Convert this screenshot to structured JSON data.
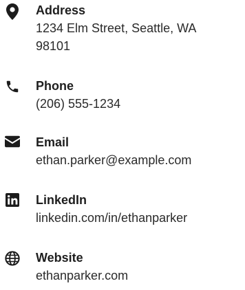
{
  "contacts": [
    {
      "icon": "map-pin-icon",
      "label": "Address",
      "value_line1": "1234 Elm Street, Seattle, WA",
      "value_line2": "98101"
    },
    {
      "icon": "phone-icon",
      "label": "Phone",
      "value": "(206) 555-1234"
    },
    {
      "icon": "envelope-icon",
      "label": "Email",
      "value": "ethan.parker@example.com"
    },
    {
      "icon": "linkedin-icon",
      "label": "LinkedIn",
      "value": "linkedin.com/in/ethanparker"
    },
    {
      "icon": "globe-icon",
      "label": "Website",
      "value": "ethanparker.com"
    }
  ],
  "colors": {
    "icon": "#1c1c1c",
    "label": "#1e1e1e",
    "value": "#2a2a2a",
    "background": "#ffffff"
  }
}
